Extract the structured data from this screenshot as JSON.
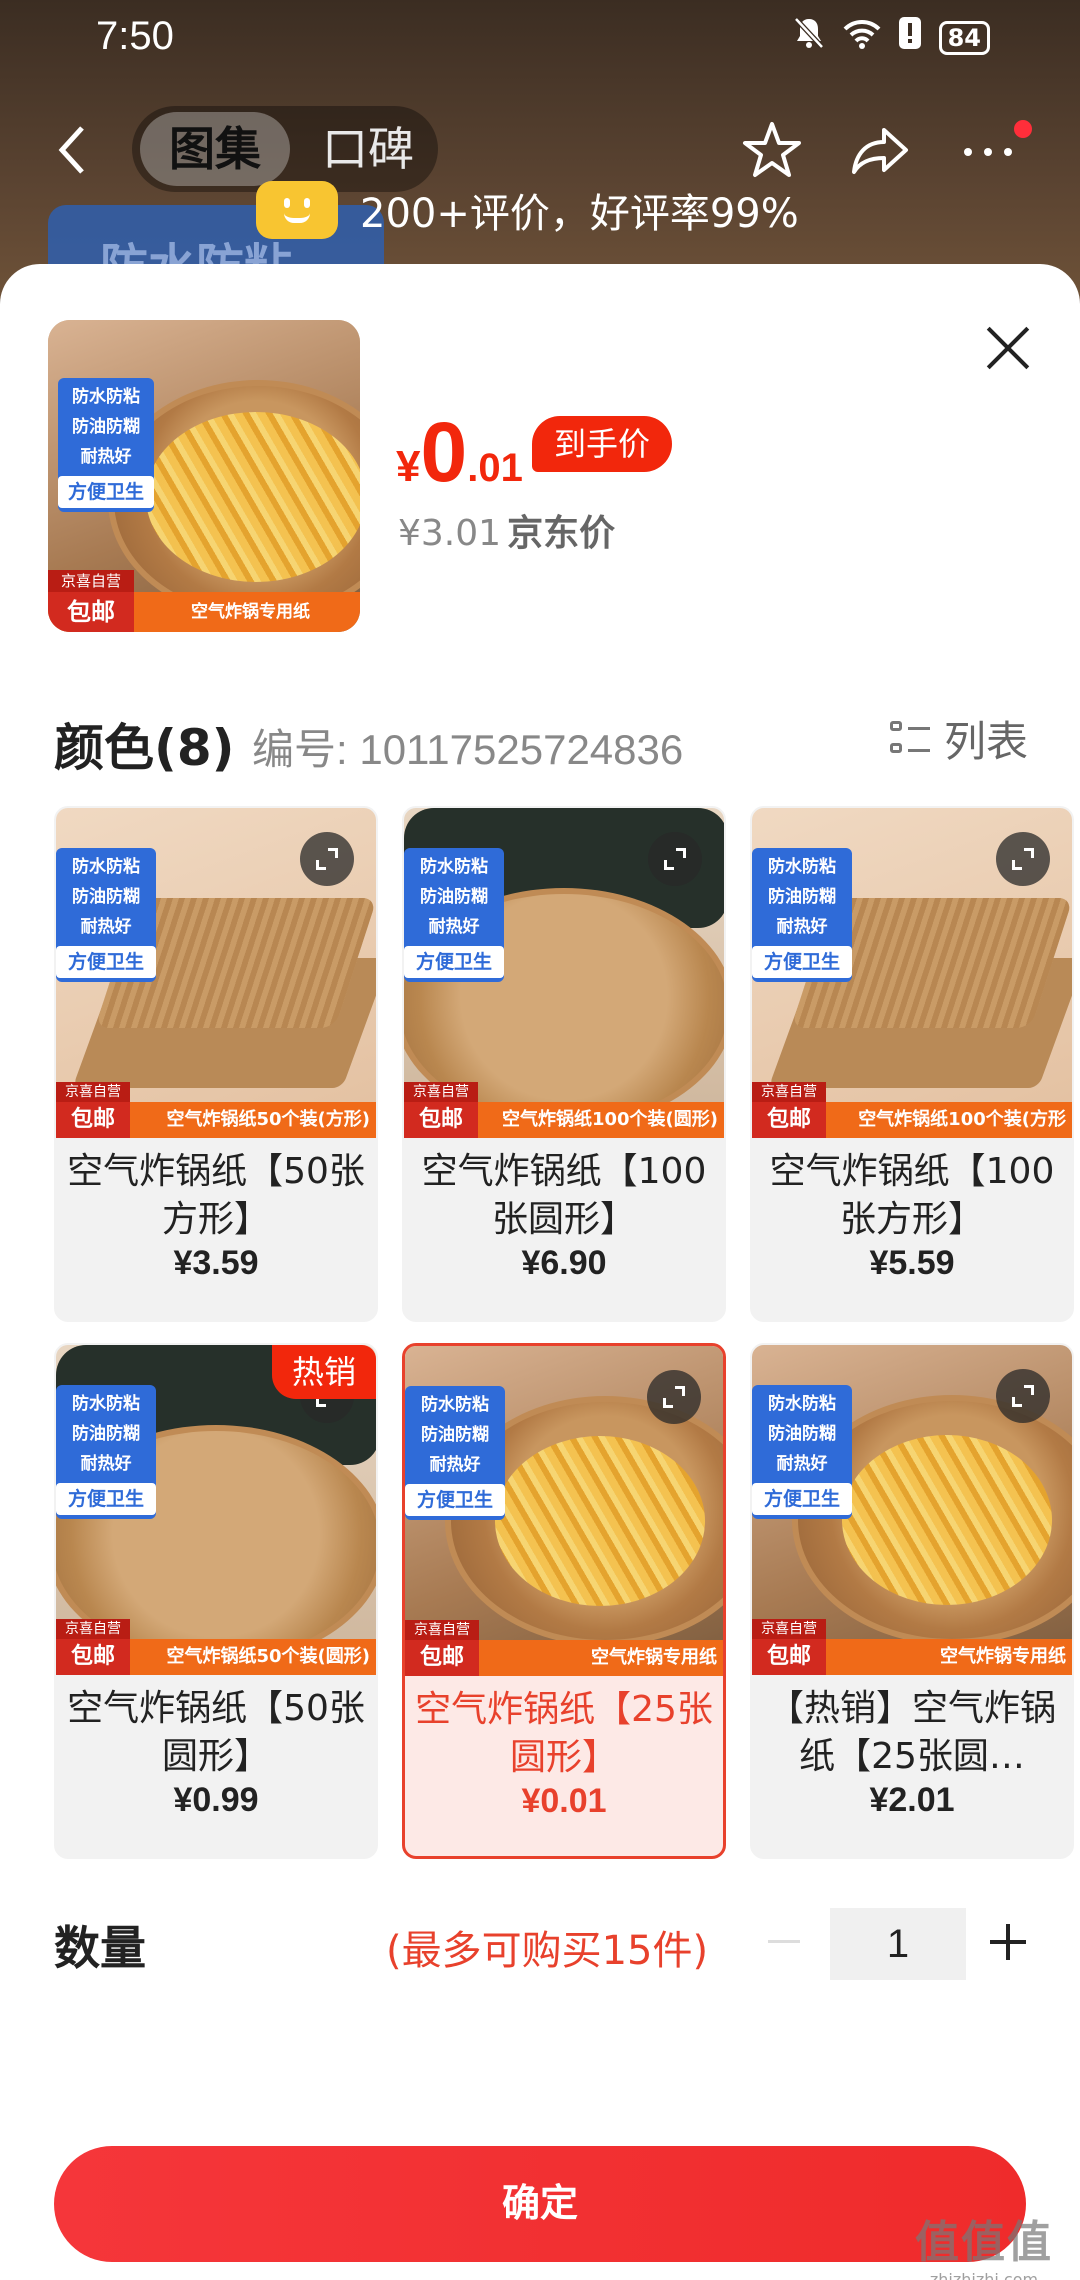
{
  "status_bar": {
    "time": "7:50",
    "battery": "84"
  },
  "nav": {
    "tab_active": "图集",
    "tab_inactive": "口碑"
  },
  "review": {
    "text": "200+评价，好评率99%"
  },
  "background_poster": {
    "text": "防水防粘"
  },
  "product": {
    "price_symbol": "¥",
    "price_int": "0",
    "price_dec": ".01",
    "price_badge": "到手价",
    "jd_price": "¥3.01",
    "jd_price_label": "京东价",
    "image": {
      "tags": [
        "防水防粘",
        "防油防糊",
        "耐热好",
        "方便卫生"
      ],
      "logo_top": "京喜自营",
      "logo_bottom": "包邮",
      "band": "空气炸锅专用纸"
    }
  },
  "variants": {
    "header": "颜色(8)",
    "sku": "编号: 10117525724836",
    "list_toggle": "列表",
    "items": [
      {
        "name": "空气炸锅纸【50张方形】",
        "price": "¥3.59",
        "band": "空气炸锅纸50个装(方形)",
        "style": "square",
        "selected": false
      },
      {
        "name": "空气炸锅纸【100张圆形】",
        "price": "¥6.90",
        "band": "空气炸锅纸100个装(圆形)",
        "style": "round-fryer",
        "selected": false
      },
      {
        "name": "空气炸锅纸【100张方形】",
        "price": "¥5.59",
        "band": "空气炸锅纸100个装(方形",
        "style": "square",
        "selected": false
      },
      {
        "name": "空气炸锅纸【50张圆形】",
        "price": "¥0.99",
        "band": "空气炸锅纸50个装(圆形)",
        "style": "round-fryer",
        "selected": false,
        "badge": "热销"
      },
      {
        "name": "空气炸锅纸【25张圆形】",
        "price": "¥0.01",
        "band": "空气炸锅专用纸",
        "style": "fries",
        "selected": true
      },
      {
        "name": "【热销】空气炸锅纸【25张圆…",
        "price": "¥2.01",
        "band": "空气炸锅专用纸",
        "style": "fries",
        "selected": false
      }
    ]
  },
  "quantity": {
    "label": "数量",
    "limit": "(最多可购买15件)",
    "minus": "−",
    "value": "1",
    "plus": "+"
  },
  "confirm_label": "确定",
  "watermark": {
    "line1": "值值值",
    "line2": "zhizhizhi.com"
  },
  "colors": {
    "accent": "#f2270c",
    "selected_border": "#e8412c",
    "tag_blue": "#2f6bd8",
    "band_orange": "#f06a18"
  }
}
